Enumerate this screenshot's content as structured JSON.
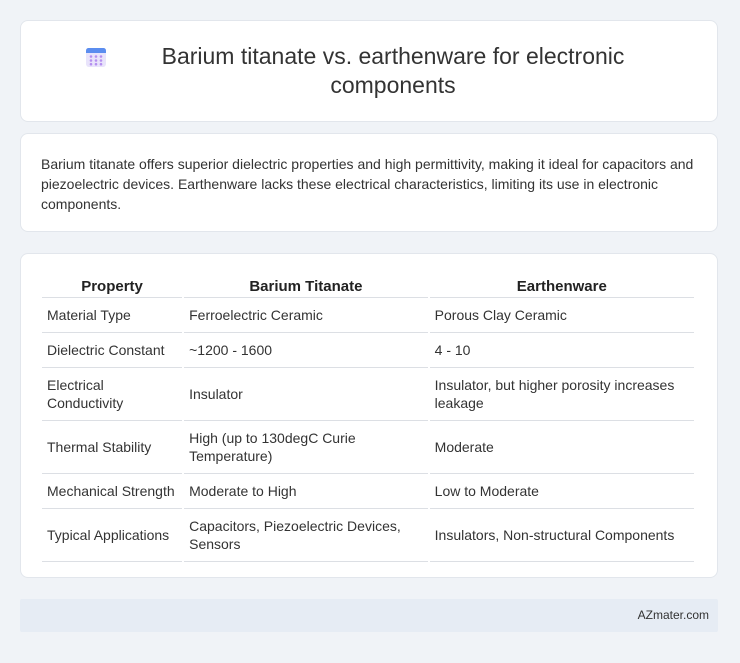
{
  "title": {
    "icon": "calendar-icon",
    "text": "Barium titanate vs. earthenware for electronic components"
  },
  "summary": "Barium titanate offers superior dielectric properties and high permittivity, making it ideal for capacitors and piezoelectric devices. Earthenware lacks these electrical characteristics, limiting its use in electronic components.",
  "table": {
    "headers": [
      "Property",
      "Barium Titanate",
      "Earthenware"
    ],
    "rows": [
      [
        "Material Type",
        "Ferroelectric Ceramic",
        "Porous Clay Ceramic"
      ],
      [
        "Dielectric Constant",
        "~1200 - 1600",
        "4 - 10"
      ],
      [
        "Electrical Conductivity",
        "Insulator",
        "Insulator, but higher porosity increases leakage"
      ],
      [
        "Thermal Stability",
        "High (up to 130degC Curie Temperature)",
        "Moderate"
      ],
      [
        "Mechanical Strength",
        "Moderate to High",
        "Low to Moderate"
      ],
      [
        "Typical Applications",
        "Capacitors, Piezoelectric Devices, Sensors",
        "Insulators, Non-structural Components"
      ]
    ]
  },
  "footer": {
    "brand": "AZmater.com"
  }
}
